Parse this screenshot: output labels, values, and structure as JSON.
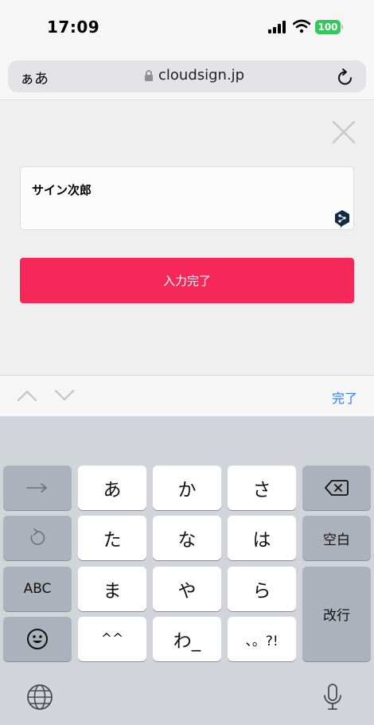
{
  "status_bar": {
    "time": "17:09",
    "battery": "100"
  },
  "browser": {
    "text_size_button": "ぁあ",
    "domain": "cloudsign.jp"
  },
  "form": {
    "name_value": "サイン次郎",
    "submit_label": "入力完了"
  },
  "toolbar": {
    "done_label": "完了"
  },
  "keyboard": {
    "kana_rows": [
      [
        "あ",
        "か",
        "さ"
      ],
      [
        "た",
        "な",
        "は"
      ],
      [
        "ま",
        "や",
        "ら"
      ],
      [
        "^^",
        "わ_",
        "、。?!"
      ]
    ],
    "space_label": "空白",
    "abc_label": "ABC",
    "return_label": "改行"
  }
}
